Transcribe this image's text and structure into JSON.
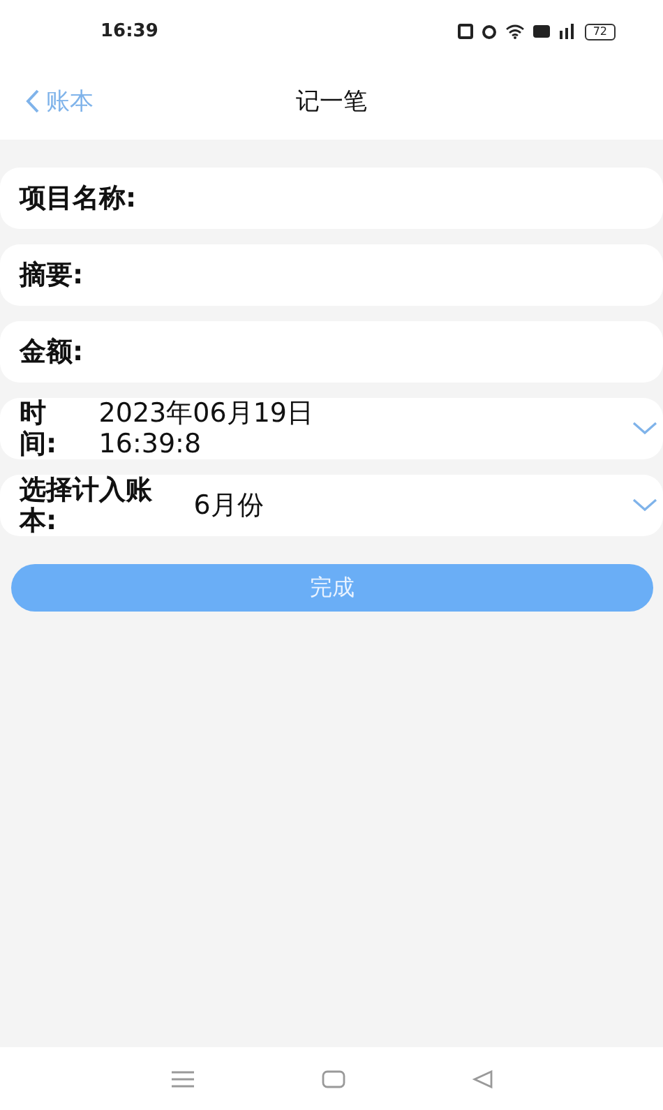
{
  "status_bar": {
    "time": "16:39",
    "battery": "72"
  },
  "nav": {
    "back": "账本",
    "title": "记一笔"
  },
  "fields": [
    {
      "kind": "input",
      "label": "项目名称:"
    },
    {
      "kind": "input",
      "label": "摘要:"
    },
    {
      "kind": "input",
      "label": "金额:"
    },
    {
      "kind": "datetime",
      "label": "时间:",
      "date": "2023年06月19日",
      "time": "16:39:8"
    },
    {
      "kind": "select",
      "label": "选择计入账本:",
      "value": "6月份"
    }
  ],
  "submit": "完成"
}
